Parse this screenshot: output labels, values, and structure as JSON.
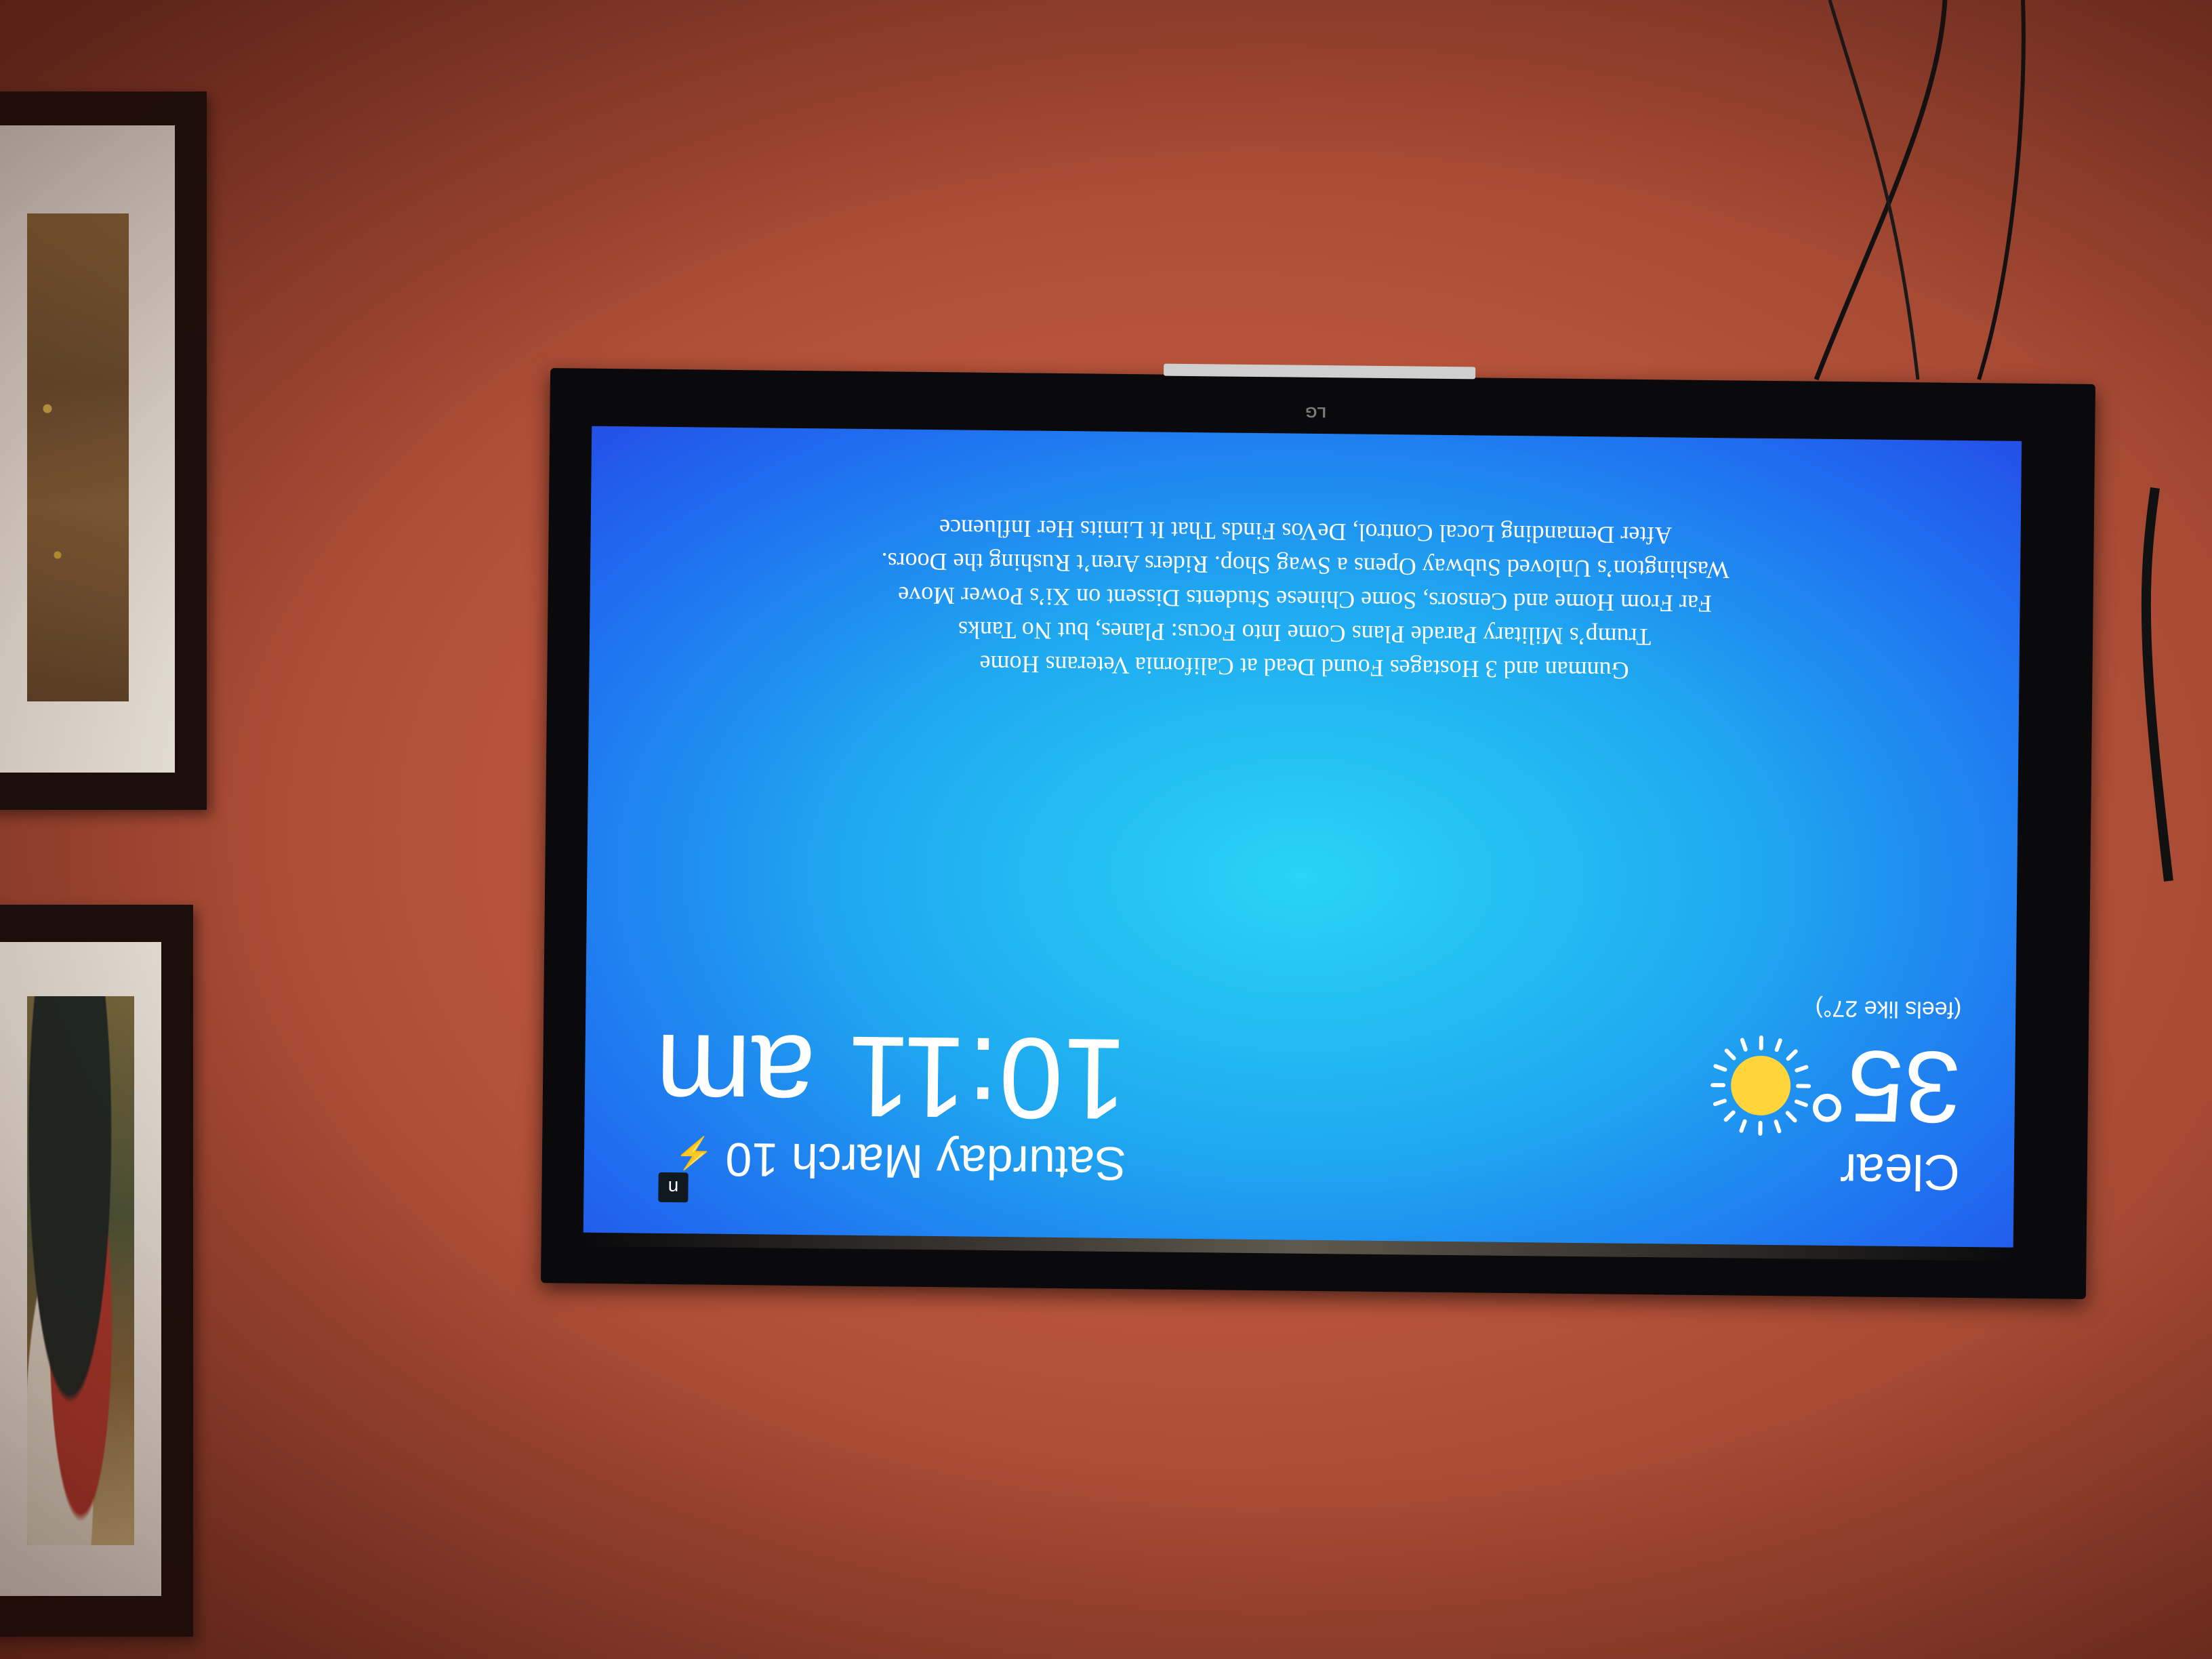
{
  "tv": {
    "brand": "LG"
  },
  "weather": {
    "condition": "Clear",
    "temperature": "35°",
    "feels_like": "(feels like 27°)",
    "icon": "sun-icon",
    "sun_color": "#ffd53a"
  },
  "clock": {
    "date": "Saturday March 10",
    "time": "10:11 am",
    "status_icon": "lightning-icon",
    "status_glyph": "⚡"
  },
  "news": {
    "source_badge": "n",
    "headlines": [
      "Gunman and 3 Hostages Found Dead at California Veterans Home",
      "Trump’s Military Parade Plans Come Into Focus: Planes, but No Tanks",
      "Far From Home and Censors, Some Chinese Students Dissent on Xi’s Power Move",
      "Washington’s Unloved Subway Opens a Swag Shop. Riders Aren’t Rushing the Doors.",
      "After Demanding Local Control, DeVos Finds That It Limits Her Influence"
    ]
  },
  "colors": {
    "wall": "#b5523a",
    "screen_center": "#29d4f5",
    "screen_edge": "#2450e8"
  }
}
